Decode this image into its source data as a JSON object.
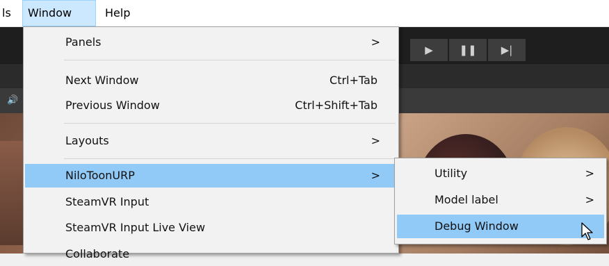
{
  "menubar": {
    "items": [
      {
        "label": "ls"
      },
      {
        "label": "Window"
      },
      {
        "label": "Help"
      }
    ]
  },
  "toolbar": {
    "play_icon": "▶",
    "pause_icon": "❚❚",
    "step_icon": "▶|"
  },
  "window_menu": {
    "items": [
      {
        "label": "Panels",
        "shortcut": "",
        "submenu_arrow": ">"
      },
      {
        "label": "Next Window",
        "shortcut": "Ctrl+Tab"
      },
      {
        "label": "Previous Window",
        "shortcut": "Ctrl+Shift+Tab"
      },
      {
        "label": "Layouts",
        "submenu_arrow": ">"
      },
      {
        "label": "NiloToonURP",
        "submenu_arrow": ">"
      },
      {
        "label": "SteamVR Input"
      },
      {
        "label": "SteamVR Input Live View"
      },
      {
        "label": "Collaborate"
      }
    ]
  },
  "nilotoon_submenu": {
    "items": [
      {
        "label": "Utility",
        "submenu_arrow": ">"
      },
      {
        "label": "Model label",
        "submenu_arrow": ">"
      },
      {
        "label": "Debug Window"
      }
    ]
  },
  "colors": {
    "highlight": "#91c9f7",
    "menubar_active": "#cce8ff",
    "menu_bg": "#f2f2f2"
  }
}
